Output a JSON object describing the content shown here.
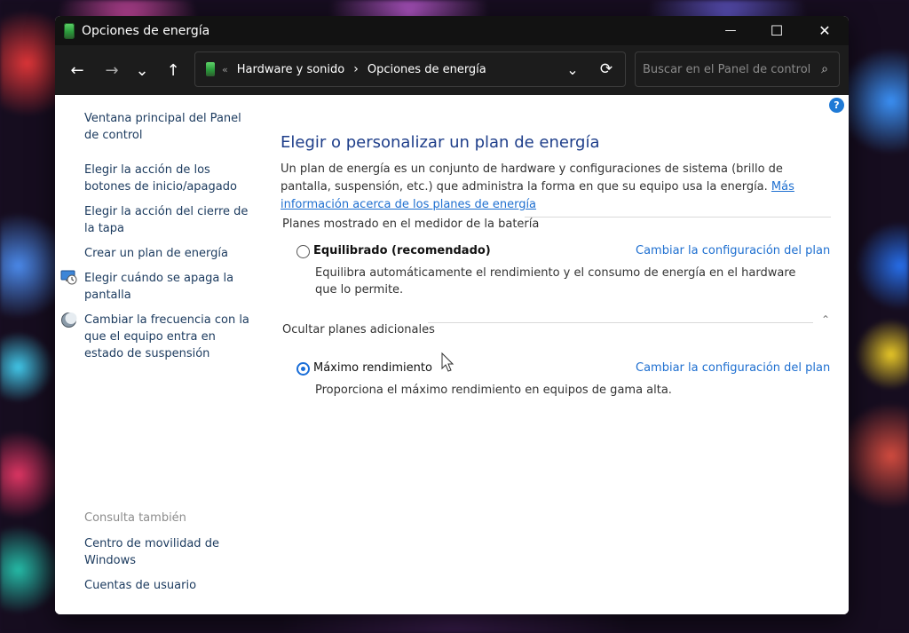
{
  "window": {
    "title": "Opciones de energía",
    "controls": {
      "minimize": "—",
      "maximize": "☐",
      "close": "✕"
    }
  },
  "addressbar": {
    "back": "←",
    "forward": "→",
    "recent": "⌄",
    "up": "↑",
    "overflow": "«",
    "crumbs": [
      "Hardware y sonido",
      "Opciones de energía"
    ],
    "separator": "›",
    "dropdown": "⌄",
    "refresh": "⟳"
  },
  "search": {
    "placeholder": "Buscar en el Panel de control",
    "icon": "⌕"
  },
  "help": {
    "glyph": "?"
  },
  "sidebar": {
    "links": [
      {
        "label": "Ventana principal del Panel de control"
      },
      {
        "label": "Elegir la acción de los botones de inicio/apagado"
      },
      {
        "label": "Elegir la acción del cierre de la tapa"
      },
      {
        "label": "Crear un plan de energía"
      },
      {
        "label": "Elegir cuándo se apaga la pantalla",
        "icon": "monitor-clock-icon"
      },
      {
        "label": "Cambiar la frecuencia con la que el equipo entra en estado de suspensión",
        "icon": "moon-icon"
      }
    ],
    "see_also_title": "Consulta también",
    "see_also": [
      {
        "label": "Centro de movilidad de Windows"
      },
      {
        "label": "Cuentas de usuario"
      }
    ]
  },
  "main": {
    "title": "Elegir o personalizar un plan de energía",
    "description": "Un plan de energía es un conjunto de hardware y configuraciones de sistema (brillo de pantalla, suspensión, etc.) que administra la forma en que su equipo usa la energía.",
    "description_link": "Más información acerca de los planes de energía",
    "group1_title": "Planes mostrado en el medidor de la batería",
    "plan1": {
      "name": "Equilibrado (recomendado)",
      "selected": false,
      "link": "Cambiar la configuración del plan",
      "description": "Equilibra automáticamente el rendimiento y el consumo de energía en el hardware que lo permite."
    },
    "group2_title": "Ocultar planes adicionales",
    "group2_chevron": "⌃",
    "plan2": {
      "name": "Máximo rendimiento",
      "selected": true,
      "link": "Cambiar la configuración del plan",
      "description": "Proporciona el máximo rendimiento en equipos de gama alta."
    }
  },
  "colors": {
    "titlebar": "#121212",
    "link": "#1e6fd0",
    "title": "#1e3e8a",
    "radio_selected": "#1a6ed8"
  }
}
